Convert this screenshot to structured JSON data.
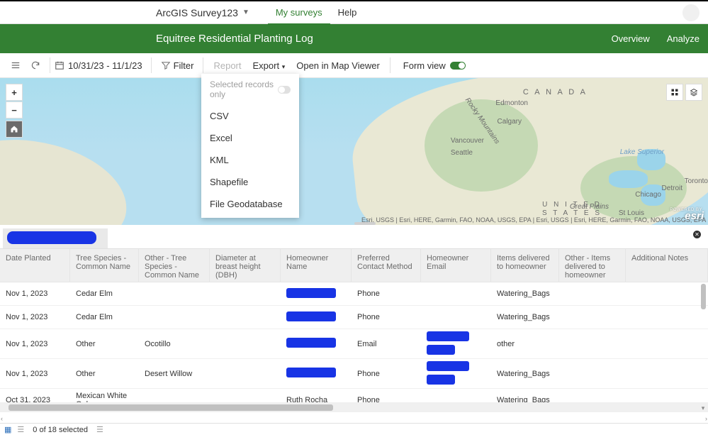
{
  "header": {
    "app_title": "ArcGIS Survey123",
    "tabs": {
      "my_surveys": "My surveys",
      "help": "Help"
    }
  },
  "greenbar": {
    "title": "Equitree Residential Planting Log",
    "overview": "Overview",
    "analyze": "Analyze"
  },
  "toolbar": {
    "date_range": "10/31/23 - 11/1/23",
    "filter": "Filter",
    "report": "Report",
    "export": "Export",
    "open_map": "Open in Map Viewer",
    "form_view": "Form view"
  },
  "export_menu": {
    "selected_only": "Selected records only",
    "csv": "CSV",
    "excel": "Excel",
    "kml": "KML",
    "shapefile": "Shapefile",
    "fgdb": "File Geodatabase"
  },
  "map": {
    "labels": {
      "canada": "C A N A D A",
      "us": "U N I T E D\nS T A T E S",
      "great_plains": "Great Plains",
      "rocky": "Rocky Mountains",
      "edmonton": "Edmonton",
      "calgary": "Calgary",
      "vancouver": "Vancouver",
      "seattle": "Seattle",
      "toronto": "Toronto",
      "detroit": "Detroit",
      "chicago": "Chicago",
      "stlouis": "St Louis",
      "superior": "Lake Superior"
    },
    "attribution_l": "Esri, USGS | Esri, HERE, Garmin, FAO, NOAA, USGS, EPA | Esri, USGS | Esri, HERE, Garmin, FAO, NOAA, USGS, EPA",
    "esri_sub": "POWERED BY",
    "esri": "esri"
  },
  "table": {
    "headers": [
      "Date Planted",
      "Tree Species - Common Name",
      "Other - Tree Species - Common Name",
      "Diameter at breast height (DBH)",
      "Homeowner Name",
      "Preferred Contact Method",
      "Homeowner Email",
      "Items delivered to homeowner",
      "Other - Items delivered to homeowner",
      "Additional Notes"
    ],
    "rows": [
      {
        "date": "Nov 1, 2023",
        "species": "Cedar Elm",
        "other_species": "",
        "dbh": "",
        "name_redact": true,
        "contact": "Phone",
        "email_redact": false,
        "items": "Watering_Bags"
      },
      {
        "date": "Nov 1, 2023",
        "species": "Cedar Elm",
        "other_species": "",
        "dbh": "",
        "name_redact": true,
        "contact": "Phone",
        "email_redact": false,
        "items": "Watering_Bags"
      },
      {
        "date": "Nov 1, 2023",
        "species": "Other",
        "other_species": "Ocotillo",
        "dbh": "",
        "name_redact": true,
        "contact": "Email",
        "email_redact": true,
        "items": "other"
      },
      {
        "date": "Nov 1, 2023",
        "species": "Other",
        "other_species": "Desert Willow",
        "dbh": "",
        "name_redact": true,
        "contact": "Phone",
        "email_redact": true,
        "items": "Watering_Bags"
      },
      {
        "date": "Oct 31, 2023",
        "species": "Mexican White Oak",
        "other_species": "",
        "dbh": "",
        "name_text": "Ruth Rocha",
        "contact": "Phone",
        "email_redact": false,
        "items": "Watering_Bags"
      }
    ]
  },
  "status": {
    "selected": "0 of 18 selected"
  }
}
